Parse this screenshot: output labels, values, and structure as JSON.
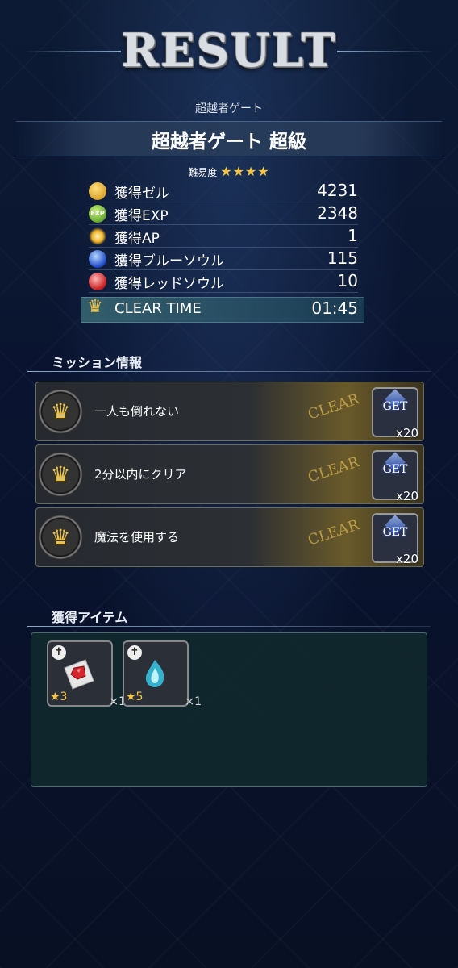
{
  "title": "RESULT",
  "stage": {
    "subtitle": "超越者ゲート",
    "name": "超越者ゲート 超級",
    "difficulty_label": "難易度",
    "difficulty_stars": "★★★★"
  },
  "stats": [
    {
      "icon": "gil-coin-icon",
      "label": "獲得ゼル",
      "value": "4231"
    },
    {
      "icon": "exp-icon",
      "label": "獲得EXP",
      "value": "2348"
    },
    {
      "icon": "ap-burst-icon",
      "label": "獲得AP",
      "value": "1"
    },
    {
      "icon": "blue-soul-icon",
      "label": "獲得ブルーソウル",
      "value": "115"
    },
    {
      "icon": "red-soul-icon",
      "label": "獲得レッドソウル",
      "value": "10"
    }
  ],
  "clear_time": {
    "label": "CLEAR TIME",
    "value": "01:45"
  },
  "missions_section": {
    "title": "ミッション情報"
  },
  "missions": [
    {
      "text": "一人も倒れない",
      "status": "CLEAR",
      "reward_label": "GET",
      "reward_qty": "x20"
    },
    {
      "text": "2分以内にクリア",
      "status": "CLEAR",
      "reward_label": "GET",
      "reward_qty": "x20"
    },
    {
      "text": "魔法を使用する",
      "status": "CLEAR",
      "reward_label": "GET",
      "reward_qty": "x20"
    }
  ],
  "items_section": {
    "title": "獲得アイテム"
  },
  "items": [
    {
      "icon": "red-gem-on-paper-icon",
      "rarity": "★3",
      "count": "×1"
    },
    {
      "icon": "blue-flame-crystal-icon",
      "rarity": "★5",
      "count": "×1"
    }
  ],
  "colors": {
    "star": "#f5c542",
    "accent_gold": "#c9a94a",
    "panel_teal": "#10282c"
  }
}
